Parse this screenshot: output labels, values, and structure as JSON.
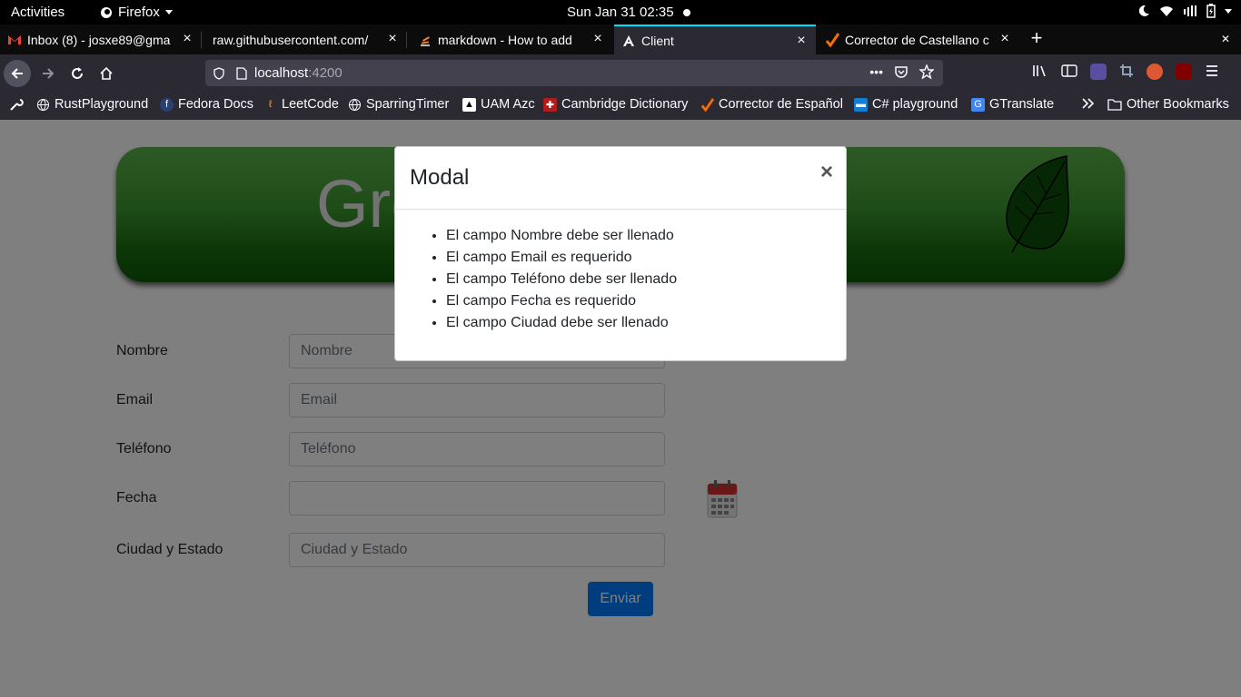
{
  "system": {
    "activities": "Activities",
    "app_name": "Firefox",
    "clock": "Sun Jan 31  02:35"
  },
  "tabs": [
    {
      "title": "Inbox (8) - josxe89@gma",
      "favicon": "gmail-icon"
    },
    {
      "title": "raw.githubusercontent.com/",
      "favicon": ""
    },
    {
      "title": "markdown - How to add",
      "favicon": "stackoverflow-icon"
    },
    {
      "title": "Client",
      "favicon": "angular-icon",
      "active": true
    },
    {
      "title": "Corrector de Castellano c",
      "favicon": "checkmark-icon"
    }
  ],
  "url": {
    "host": "localhost",
    "port": ":4200"
  },
  "bookmarks": [
    {
      "label": "RustPlayground",
      "icon": "globe-icon"
    },
    {
      "label": "Fedora Docs",
      "icon": "fedora-icon"
    },
    {
      "label": "LeetCode",
      "icon": "leetcode-icon"
    },
    {
      "label": "SparringTimer",
      "icon": "globe-icon"
    },
    {
      "label": "UAM Azc",
      "icon": "uam-icon"
    },
    {
      "label": "Cambridge Dictionary",
      "icon": "cambridge-icon"
    },
    {
      "label": "Corrector de Español",
      "icon": "checkmark-icon"
    },
    {
      "label": "C# playground",
      "icon": "csharp-icon"
    },
    {
      "label": "GTranslate",
      "icon": "gtranslate-icon"
    }
  ],
  "other_bookmarks": "Other Bookmarks",
  "page": {
    "banner_title": "Gre",
    "form": {
      "nombre_label": "Nombre",
      "nombre_placeholder": "Nombre",
      "email_label": "Email",
      "email_placeholder": "Email",
      "telefono_label": "Teléfono",
      "telefono_placeholder": "Teléfono",
      "fecha_label": "Fecha",
      "fecha_value": "",
      "ciudad_label": "Ciudad y Estado",
      "ciudad_placeholder": "Ciudad y Estado",
      "submit_label": "Enviar"
    }
  },
  "modal": {
    "title": "Modal",
    "close": "×",
    "errors": [
      "El campo Nombre debe ser llenado",
      "El campo Email es requerido",
      "El campo Teléfono debe ser llenado",
      "El campo Fecha es requerido",
      "El campo Ciudad debe ser llenado"
    ]
  },
  "colors": {
    "accent": "#007bff",
    "banner_green": "#3d9a30",
    "active_tab_line": "#00ddff"
  }
}
